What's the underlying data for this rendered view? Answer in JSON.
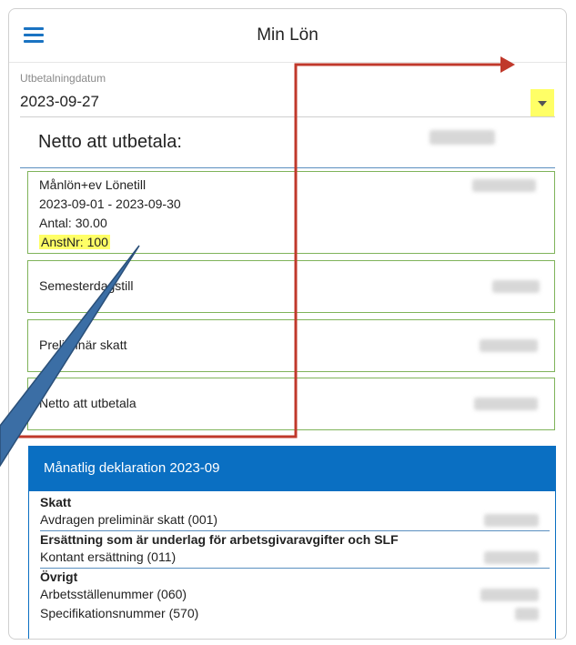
{
  "app": {
    "title": "Min Lön"
  },
  "payment": {
    "date_label": "Utbetalningdatum",
    "date_value": "2023-09-27",
    "net_label": "Netto att utbetala:"
  },
  "lines": [
    {
      "title": "Månlön+ev Lönetill",
      "period": "2023-09-01 - 2023-09-30",
      "count": "Antal: 30.00",
      "employee": "AnstNr: 100"
    },
    {
      "title": "Semesterdagstill"
    },
    {
      "title": "Preliminär skatt"
    },
    {
      "title": "Netto att utbetala"
    }
  ],
  "declaration": {
    "title": "Månatlig deklaration 2023-09",
    "sections": [
      {
        "heading": "Skatt",
        "items": [
          "Avdragen preliminär skatt (001)"
        ]
      },
      {
        "heading": "Ersättning som är underlag för arbetsgivaravgifter och SLF",
        "items": [
          "Kontant ersättning (011)"
        ]
      },
      {
        "heading": "Övrigt",
        "items": [
          "Arbetsställenummer (060)",
          "Specifikationsnummer (570)"
        ]
      }
    ]
  },
  "colors": {
    "accent": "#0a6fc2",
    "card_border": "#7fb35a",
    "highlight": "#ffff66",
    "annotation_red": "#c0392b",
    "callout_blue": "#3b6ea5"
  },
  "icons": {
    "menu": "hamburger-icon",
    "dropdown": "dropdown-arrow-icon"
  }
}
